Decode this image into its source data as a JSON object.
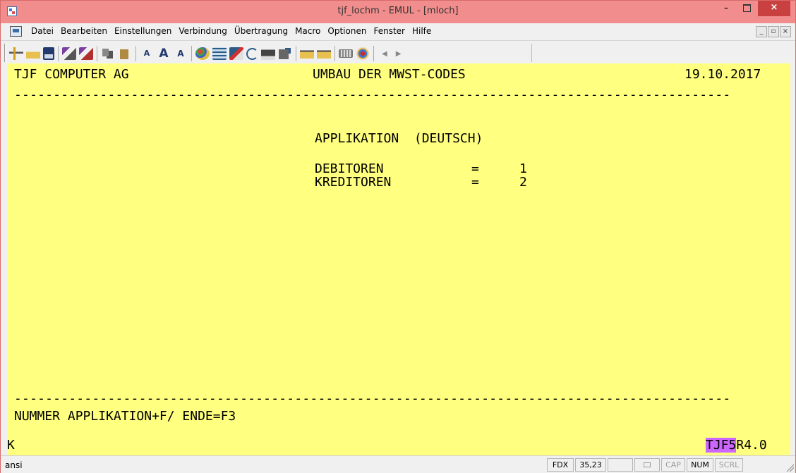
{
  "window": {
    "title": "tjf_lochm - EMUL - [mloch]",
    "controls": {
      "minimize": "–",
      "close": "×"
    }
  },
  "menu": {
    "items": [
      "Datei",
      "Bearbeiten",
      "Einstellungen",
      "Verbindung",
      "Übertragung",
      "Macro",
      "Optionen",
      "Fenster",
      "Hilfe"
    ],
    "mdi": {
      "minimize": "_",
      "restore": "▫",
      "close": "×"
    }
  },
  "toolbar": {
    "icons": [
      "connect-icon",
      "open-icon",
      "save-icon",
      "send-icon",
      "receive-icon",
      "copy-icon",
      "paste-icon",
      "font-small-icon",
      "font-large-icon",
      "font-medium-icon",
      "palette-icon",
      "grid-icon",
      "record-icon",
      "undo-icon",
      "print-icon",
      "settings-icon",
      "folder-a-icon",
      "folder-b-icon",
      "keyboard-icon",
      "macro-icon"
    ],
    "nav_prev": "◀",
    "nav_next": "▶"
  },
  "terminal": {
    "company": "TJF COMPUTER AG",
    "screen_title": "UMBAU DER MWST-CODES",
    "date": "19.10.2017",
    "separator": "--------------------------------------------------------------------------------------------",
    "heading": "APPLIKATION  (DEUTSCH)",
    "options": [
      {
        "label": "DEBITOREN",
        "eq": "=",
        "value": "1"
      },
      {
        "label": "KREDITOREN",
        "eq": "=",
        "value": "2"
      }
    ],
    "prompt": "NUMMER APPLIKATION+F/ ENDE=F3",
    "cursor_char": "K",
    "version_highlight": "TJF5",
    "version_rest": "R4.0",
    "colors": {
      "background": "#ffff80",
      "version_highlight": "#cc66ff"
    }
  },
  "statusbar": {
    "encoding": "ansi",
    "mode": "FDX",
    "cursor_pos": "35,23",
    "cap": "CAP",
    "num": "NUM",
    "scrl": "SCRL"
  }
}
